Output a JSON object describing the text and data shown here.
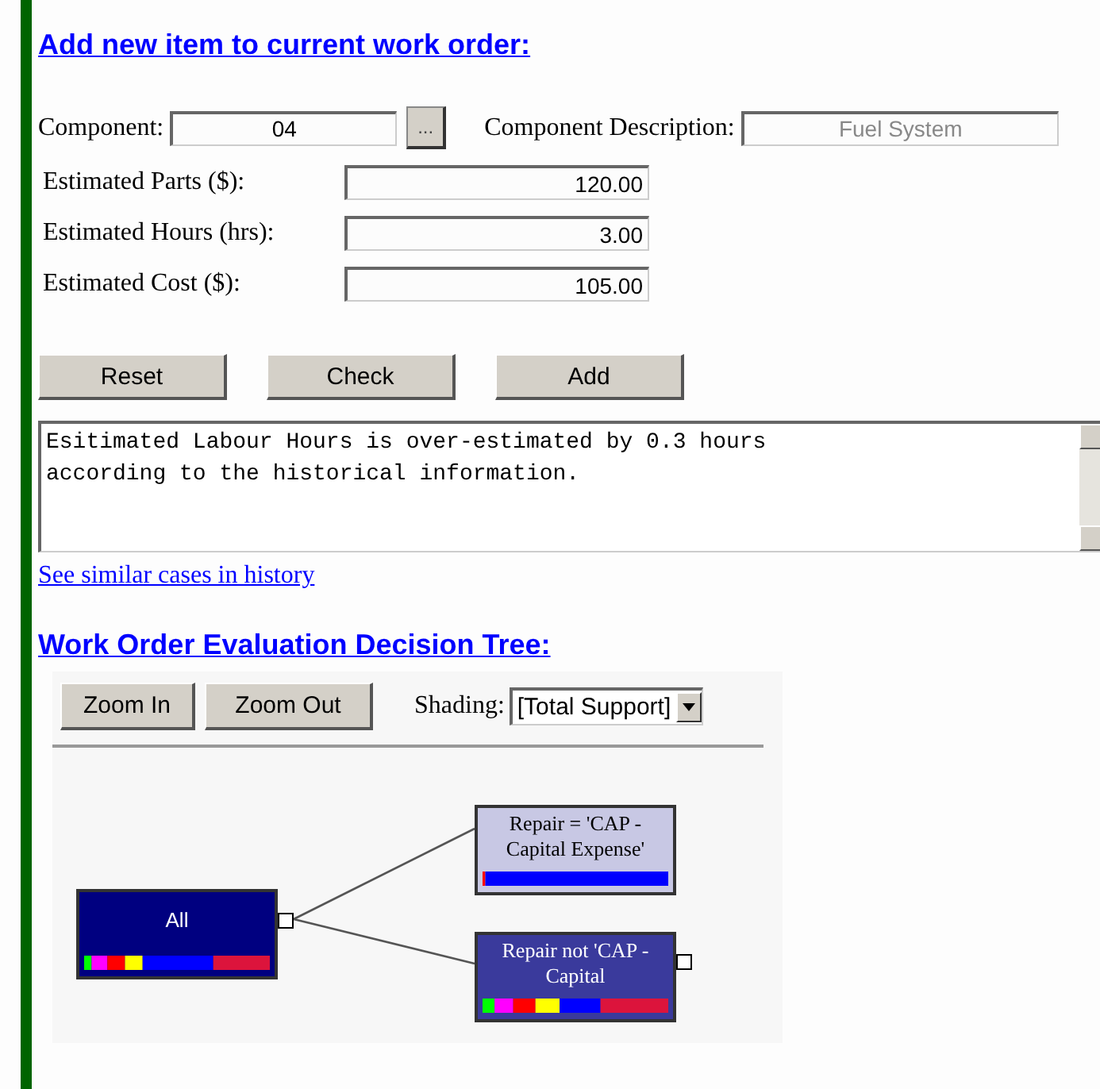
{
  "heading": "Add new item to current work order:",
  "component": {
    "label": "Component:",
    "value": "04",
    "browse": "...",
    "description_label": "Component Description:",
    "description": "Fuel System"
  },
  "fields": [
    {
      "label": "Estimated Parts ($):",
      "value": "120.00"
    },
    {
      "label": "Estimated Hours (hrs):",
      "value": "3.00"
    },
    {
      "label": "Estimated Cost ($):",
      "value": "105.00"
    }
  ],
  "buttons": [
    "Reset",
    "Check",
    "Add"
  ],
  "message": "Esitimated Labour Hours is over-estimated by 0.3 hours\naccording to the historical information.",
  "history_link": "See similar cases in history",
  "tree_heading": "Work Order Evaluation Decision Tree:",
  "tree_toolbar": {
    "buttons": [
      "Zoom In",
      "Zoom Out"
    ],
    "shading_label": "Shading:",
    "shading_value": "[Total Support]"
  },
  "tree": {
    "label": "All",
    "selected": true,
    "expandable": true,
    "children": [
      {
        "label": "Repair = 'CAP - Capital Expense'",
        "selected": false,
        "expandable": false
      },
      {
        "label": "Repair not 'CAP - Capital",
        "selected": true,
        "expandable": true
      }
    ]
  }
}
